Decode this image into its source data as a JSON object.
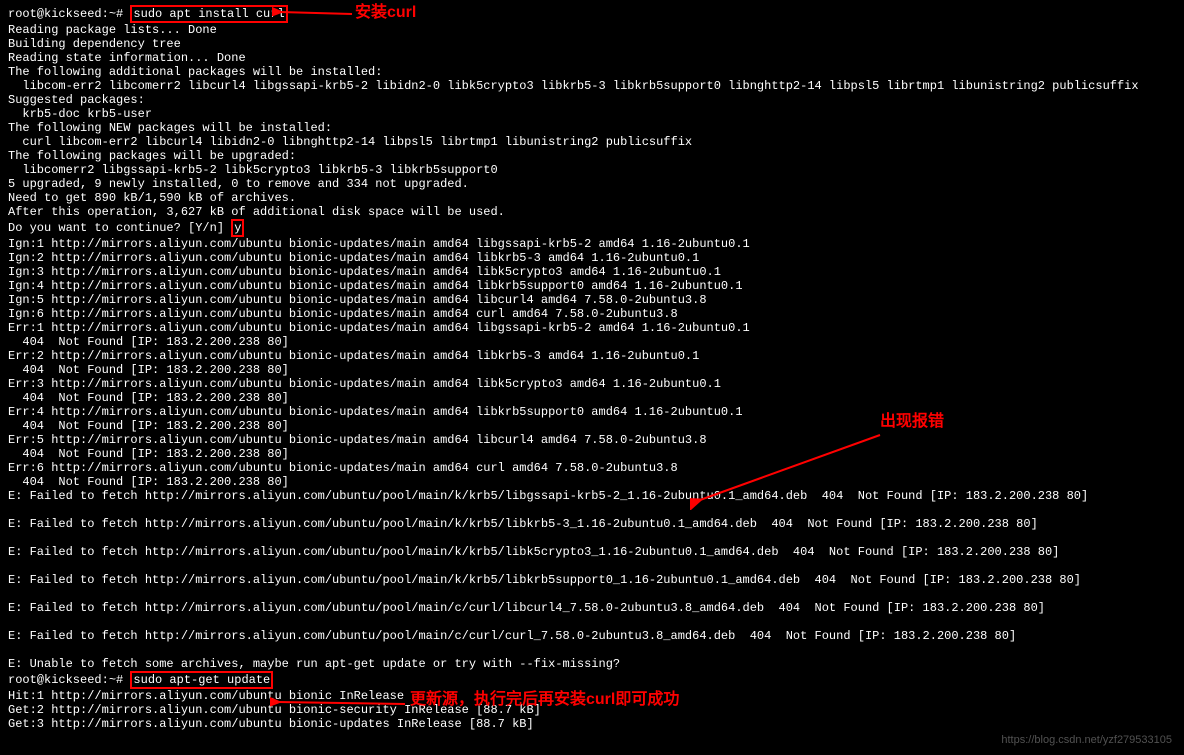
{
  "prompt1": "root@kickseed:~# ",
  "cmd1": "sudo apt install curl",
  "annotation1": "安装curl",
  "lines_block1": [
    "Reading package lists... Done",
    "Building dependency tree",
    "Reading state information... Done",
    "The following additional packages will be installed:",
    "  libcom-err2 libcomerr2 libcurl4 libgssapi-krb5-2 libidn2-0 libk5crypto3 libkrb5-3 libkrb5support0 libnghttp2-14 libpsl5 librtmp1 libunistring2 publicsuffix",
    "Suggested packages:",
    "  krb5-doc krb5-user",
    "The following NEW packages will be installed:",
    "  curl libcom-err2 libcurl4 libidn2-0 libnghttp2-14 libpsl5 librtmp1 libunistring2 publicsuffix",
    "The following packages will be upgraded:",
    "  libcomerr2 libgssapi-krb5-2 libk5crypto3 libkrb5-3 libkrb5support0",
    "5 upgraded, 9 newly installed, 0 to remove and 334 not upgraded.",
    "Need to get 890 kB/1,590 kB of archives.",
    "After this operation, 3,627 kB of additional disk space will be used."
  ],
  "continue_prefix": "Do you want to continue? [Y/n] ",
  "continue_input": "y",
  "lines_block2": [
    "Ign:1 http://mirrors.aliyun.com/ubuntu bionic-updates/main amd64 libgssapi-krb5-2 amd64 1.16-2ubuntu0.1",
    "Ign:2 http://mirrors.aliyun.com/ubuntu bionic-updates/main amd64 libkrb5-3 amd64 1.16-2ubuntu0.1",
    "Ign:3 http://mirrors.aliyun.com/ubuntu bionic-updates/main amd64 libk5crypto3 amd64 1.16-2ubuntu0.1",
    "Ign:4 http://mirrors.aliyun.com/ubuntu bionic-updates/main amd64 libkrb5support0 amd64 1.16-2ubuntu0.1",
    "Ign:5 http://mirrors.aliyun.com/ubuntu bionic-updates/main amd64 libcurl4 amd64 7.58.0-2ubuntu3.8",
    "Ign:6 http://mirrors.aliyun.com/ubuntu bionic-updates/main amd64 curl amd64 7.58.0-2ubuntu3.8",
    "Err:1 http://mirrors.aliyun.com/ubuntu bionic-updates/main amd64 libgssapi-krb5-2 amd64 1.16-2ubuntu0.1",
    "  404  Not Found [IP: 183.2.200.238 80]",
    "Err:2 http://mirrors.aliyun.com/ubuntu bionic-updates/main amd64 libkrb5-3 amd64 1.16-2ubuntu0.1",
    "  404  Not Found [IP: 183.2.200.238 80]",
    "Err:3 http://mirrors.aliyun.com/ubuntu bionic-updates/main amd64 libk5crypto3 amd64 1.16-2ubuntu0.1",
    "  404  Not Found [IP: 183.2.200.238 80]",
    "Err:4 http://mirrors.aliyun.com/ubuntu bionic-updates/main amd64 libkrb5support0 amd64 1.16-2ubuntu0.1",
    "  404  Not Found [IP: 183.2.200.238 80]",
    "Err:5 http://mirrors.aliyun.com/ubuntu bionic-updates/main amd64 libcurl4 amd64 7.58.0-2ubuntu3.8",
    "  404  Not Found [IP: 183.2.200.238 80]",
    "Err:6 http://mirrors.aliyun.com/ubuntu bionic-updates/main amd64 curl amd64 7.58.0-2ubuntu3.8",
    "  404  Not Found [IP: 183.2.200.238 80]",
    "E: Failed to fetch http://mirrors.aliyun.com/ubuntu/pool/main/k/krb5/libgssapi-krb5-2_1.16-2ubuntu0.1_amd64.deb  404  Not Found [IP: 183.2.200.238 80]",
    "",
    "E: Failed to fetch http://mirrors.aliyun.com/ubuntu/pool/main/k/krb5/libkrb5-3_1.16-2ubuntu0.1_amd64.deb  404  Not Found [IP: 183.2.200.238 80]",
    "",
    "E: Failed to fetch http://mirrors.aliyun.com/ubuntu/pool/main/k/krb5/libk5crypto3_1.16-2ubuntu0.1_amd64.deb  404  Not Found [IP: 183.2.200.238 80]",
    "",
    "E: Failed to fetch http://mirrors.aliyun.com/ubuntu/pool/main/k/krb5/libkrb5support0_1.16-2ubuntu0.1_amd64.deb  404  Not Found [IP: 183.2.200.238 80]",
    "",
    "E: Failed to fetch http://mirrors.aliyun.com/ubuntu/pool/main/c/curl/libcurl4_7.58.0-2ubuntu3.8_amd64.deb  404  Not Found [IP: 183.2.200.238 80]",
    "",
    "E: Failed to fetch http://mirrors.aliyun.com/ubuntu/pool/main/c/curl/curl_7.58.0-2ubuntu3.8_amd64.deb  404  Not Found [IP: 183.2.200.238 80]",
    "",
    "E: Unable to fetch some archives, maybe run apt-get update or try with --fix-missing?"
  ],
  "prompt2": "root@kickseed:~# ",
  "cmd2": "sudo apt-get update",
  "annotation2": "出现报错",
  "annotation3": "更新源，执行完后再安装curl即可成功",
  "lines_block3": [
    "Hit:1 http://mirrors.aliyun.com/ubuntu bionic InRelease",
    "Get:2 http://mirrors.aliyun.com/ubuntu bionic-security InRelease [88.7 kB]",
    "Get:3 http://mirrors.aliyun.com/ubuntu bionic-updates InRelease [88.7 kB]"
  ],
  "watermark": "https://blog.csdn.net/yzf279533105"
}
